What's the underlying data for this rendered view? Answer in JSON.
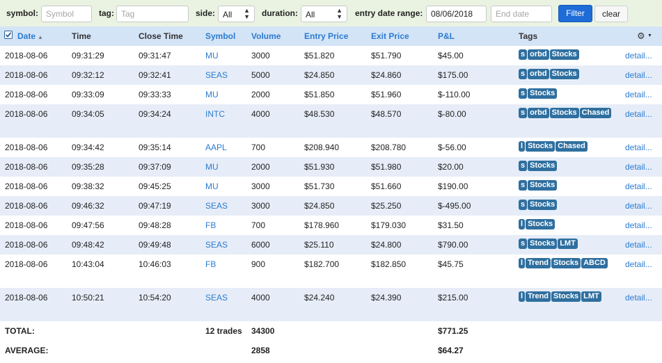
{
  "filters": {
    "symbol_label": "symbol:",
    "symbol_placeholder": "Symbol",
    "tag_label": "tag:",
    "tag_placeholder": "Tag",
    "side_label": "side:",
    "side_value": "All",
    "duration_label": "duration:",
    "duration_value": "All",
    "entry_range_label": "entry date range:",
    "start_date_value": "08/06/2018",
    "end_date_placeholder": "End date",
    "filter_button": "Filter",
    "clear_button": "clear"
  },
  "columns": {
    "date": "Date",
    "time": "Time",
    "close_time": "Close Time",
    "symbol": "Symbol",
    "volume": "Volume",
    "entry_price": "Entry Price",
    "exit_price": "Exit Price",
    "pnl": "P&L",
    "tags": "Tags"
  },
  "detail_label": "detail...",
  "rows": [
    {
      "date": "2018-08-06",
      "time": "09:31:29",
      "close": "09:31:47",
      "symbol": "MU",
      "volume": "3000",
      "entry": "$51.820",
      "exit": "$51.790",
      "pnl": "$45.00",
      "tags": [
        "s",
        "orbd",
        "Stocks"
      ]
    },
    {
      "date": "2018-08-06",
      "time": "09:32:12",
      "close": "09:32:41",
      "symbol": "SEAS",
      "volume": "5000",
      "entry": "$24.850",
      "exit": "$24.860",
      "pnl": "$175.00",
      "tags": [
        "s",
        "orbd",
        "Stocks"
      ]
    },
    {
      "date": "2018-08-06",
      "time": "09:33:09",
      "close": "09:33:33",
      "symbol": "MU",
      "volume": "2000",
      "entry": "$51.850",
      "exit": "$51.960",
      "pnl": "$-110.00",
      "tags": [
        "s",
        "Stocks"
      ]
    },
    {
      "date": "2018-08-06",
      "time": "09:34:05",
      "close": "09:34:24",
      "symbol": "INTC",
      "volume": "4000",
      "entry": "$48.530",
      "exit": "$48.570",
      "pnl": "$-80.00",
      "tags": [
        "s",
        "orbd",
        "Stocks",
        "Chased"
      ]
    },
    {
      "date": "2018-08-06",
      "time": "09:34:42",
      "close": "09:35:14",
      "symbol": "AAPL",
      "volume": "700",
      "entry": "$208.940",
      "exit": "$208.780",
      "pnl": "$-56.00",
      "tags": [
        "l",
        "Stocks",
        "Chased"
      ]
    },
    {
      "date": "2018-08-06",
      "time": "09:35:28",
      "close": "09:37:09",
      "symbol": "MU",
      "volume": "2000",
      "entry": "$51.930",
      "exit": "$51.980",
      "pnl": "$20.00",
      "tags": [
        "s",
        "Stocks"
      ]
    },
    {
      "date": "2018-08-06",
      "time": "09:38:32",
      "close": "09:45:25",
      "symbol": "MU",
      "volume": "3000",
      "entry": "$51.730",
      "exit": "$51.660",
      "pnl": "$190.00",
      "tags": [
        "s",
        "Stocks"
      ]
    },
    {
      "date": "2018-08-06",
      "time": "09:46:32",
      "close": "09:47:19",
      "symbol": "SEAS",
      "volume": "3000",
      "entry": "$24.850",
      "exit": "$25.250",
      "pnl": "$-495.00",
      "tags": [
        "s",
        "Stocks"
      ]
    },
    {
      "date": "2018-08-06",
      "time": "09:47:56",
      "close": "09:48:28",
      "symbol": "FB",
      "volume": "700",
      "entry": "$178.960",
      "exit": "$179.030",
      "pnl": "$31.50",
      "tags": [
        "l",
        "Stocks"
      ]
    },
    {
      "date": "2018-08-06",
      "time": "09:48:42",
      "close": "09:49:48",
      "symbol": "SEAS",
      "volume": "6000",
      "entry": "$25.110",
      "exit": "$24.800",
      "pnl": "$790.00",
      "tags": [
        "s",
        "Stocks",
        "LMT"
      ]
    },
    {
      "date": "2018-08-06",
      "time": "10:43:04",
      "close": "10:46:03",
      "symbol": "FB",
      "volume": "900",
      "entry": "$182.700",
      "exit": "$182.850",
      "pnl": "$45.75",
      "tags": [
        "l",
        "Trend",
        "Stocks",
        "ABCD"
      ]
    },
    {
      "date": "2018-08-06",
      "time": "10:50:21",
      "close": "10:54:20",
      "symbol": "SEAS",
      "volume": "4000",
      "entry": "$24.240",
      "exit": "$24.390",
      "pnl": "$215.00",
      "tags": [
        "l",
        "Trend",
        "Stocks",
        "LMT"
      ]
    }
  ],
  "totals": {
    "total_label": "TOTAL:",
    "trades": "12 trades",
    "volume": "34300",
    "pnl": "$771.25",
    "average_label": "AVERAGE:",
    "avg_volume": "2858",
    "avg_pnl": "$64.27"
  },
  "colors": {
    "filter_bar_bg": "#eaf3e2",
    "header_bg": "#d4e4f7",
    "row_alt_bg": "#e6edf8",
    "link": "#2b7bd0",
    "tag_bg": "#2f6f9f",
    "filter_button_bg": "#1e6cd8"
  }
}
